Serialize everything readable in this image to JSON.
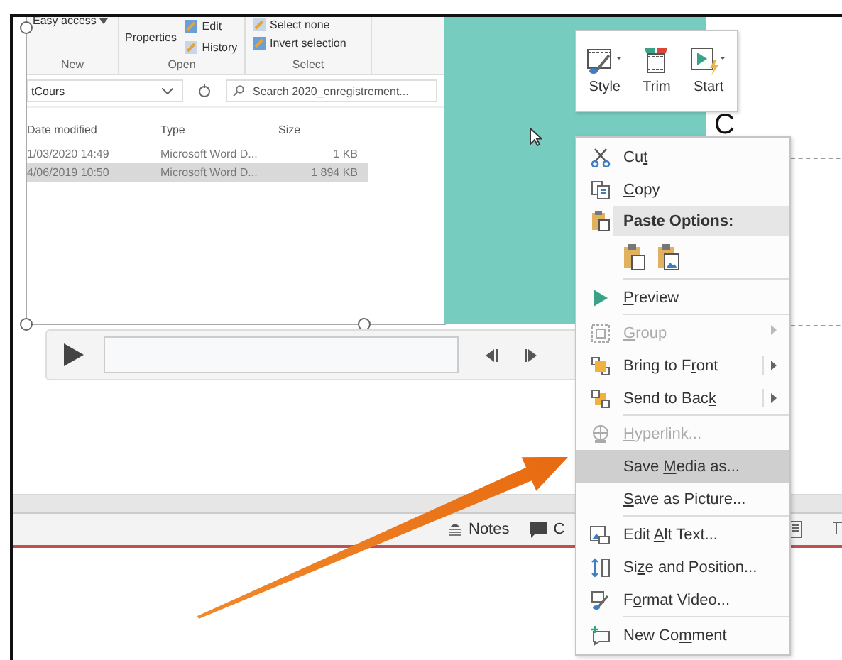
{
  "slide": {
    "title_fragment": "C"
  },
  "explorer": {
    "ribbon": [
      {
        "group": "New",
        "commands": [
          "Easy access"
        ]
      },
      {
        "group": "Open",
        "commands": [
          "Properties",
          "Edit",
          "History"
        ]
      },
      {
        "group": "Select",
        "commands": [
          "Select none",
          "Invert selection"
        ]
      }
    ],
    "path": "tCours",
    "search": {
      "placeholder": "Search 2020_enregistrement..."
    },
    "columns": [
      "Date modified",
      "Type",
      "Size"
    ],
    "rows": [
      {
        "cells": [
          "1/03/2020 14:49",
          "Microsoft Word D...",
          "1 KB"
        ],
        "selected": false
      },
      {
        "cells": [
          "4/06/2019 10:50",
          "Microsoft Word D...",
          "1 894 KB"
        ],
        "selected": true
      }
    ]
  },
  "mini_toolbar": [
    "Style",
    "Trim",
    "Start"
  ],
  "context_menu": [
    {
      "kind": "item",
      "pre": "Cu",
      "key": "t",
      "disabled": false,
      "selected": false,
      "submenu": false,
      "divider": false
    },
    {
      "kind": "item",
      "key": "C",
      "post": "opy",
      "disabled": false,
      "selected": false,
      "submenu": false,
      "divider": false
    },
    {
      "kind": "header",
      "label": "Paste Options:"
    },
    {
      "kind": "paste-icons"
    },
    {
      "kind": "item",
      "key": "P",
      "post": "review",
      "disabled": false,
      "selected": false,
      "submenu": false,
      "divider": true
    },
    {
      "kind": "item",
      "key": "G",
      "post": "roup",
      "disabled": true,
      "selected": false,
      "submenu": true,
      "divider": true
    },
    {
      "kind": "item",
      "pre": "Bring to F",
      "key": "r",
      "post": "ont",
      "disabled": false,
      "selected": false,
      "submenu": true,
      "divider": false
    },
    {
      "kind": "item",
      "pre": "Send to Bac",
      "key": "k",
      "disabled": false,
      "selected": false,
      "submenu": true,
      "divider": false
    },
    {
      "kind": "item",
      "key": "H",
      "post": "yperlink...",
      "disabled": true,
      "selected": false,
      "submenu": false,
      "divider": true
    },
    {
      "kind": "item",
      "pre": "Save ",
      "key": "M",
      "post": "edia as...",
      "disabled": false,
      "selected": true,
      "submenu": false,
      "divider": false
    },
    {
      "kind": "item",
      "key": "S",
      "post": "ave as Picture...",
      "disabled": false,
      "selected": false,
      "submenu": false,
      "divider": false
    },
    {
      "kind": "item",
      "pre": "Edit ",
      "key": "A",
      "post": "lt Text...",
      "disabled": false,
      "selected": false,
      "submenu": false,
      "divider": true
    },
    {
      "kind": "item",
      "pre": "Si",
      "key": "z",
      "post": "e and Position...",
      "disabled": false,
      "selected": false,
      "submenu": false,
      "divider": false
    },
    {
      "kind": "item",
      "pre": "F",
      "key": "o",
      "post": "rmat Video...",
      "disabled": false,
      "selected": false,
      "submenu": false,
      "divider": false
    },
    {
      "kind": "item",
      "pre": "New Co",
      "key": "m",
      "post": "ment",
      "disabled": false,
      "selected": false,
      "submenu": false,
      "divider": true
    }
  ],
  "status_bar": {
    "notes": "Notes",
    "comments": "C"
  }
}
